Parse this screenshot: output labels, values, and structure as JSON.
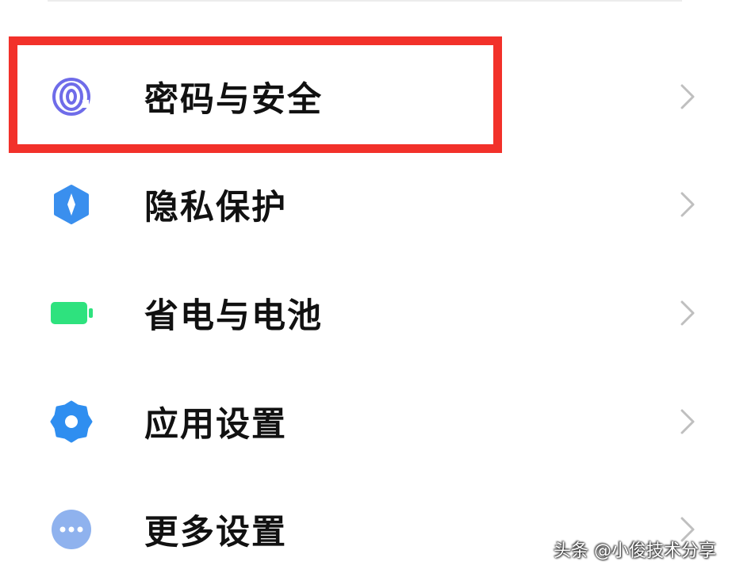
{
  "settings": {
    "items": [
      {
        "label": "密码与安全",
        "icon": "fingerprint-icon",
        "color": "#6f6ce9",
        "highlighted": true
      },
      {
        "label": "隐私保护",
        "icon": "privacy-shield-icon",
        "color": "#3a8fee"
      },
      {
        "label": "省电与电池",
        "icon": "battery-icon",
        "color": "#2ee27e"
      },
      {
        "label": "应用设置",
        "icon": "gear-icon",
        "color": "#2f8ef0"
      },
      {
        "label": "更多设置",
        "icon": "more-dots-icon",
        "color": "#8fb2ee"
      }
    ]
  },
  "highlight": {
    "color": "#f2312a"
  },
  "watermark": {
    "text": "头条 @小俊技术分享"
  }
}
